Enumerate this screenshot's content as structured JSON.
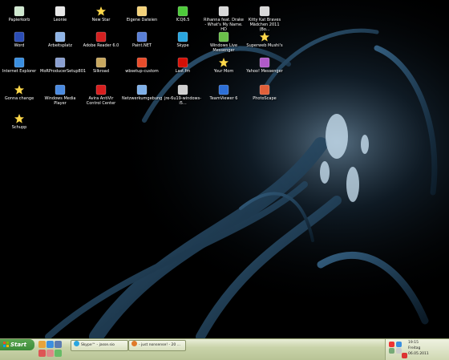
{
  "desktop_icons": [
    {
      "label": "Papierkorb",
      "icon": "recycle-bin-icon",
      "color": "#cfe8cf"
    },
    {
      "label": "Leonie",
      "icon": "document-icon",
      "color": "#e8e8e8"
    },
    {
      "label": "New Star",
      "icon": "star-icon",
      "color": "#ffd84a"
    },
    {
      "label": "Eigene Dateien",
      "icon": "folder-icon",
      "color": "#f4d27a"
    },
    {
      "label": "ICQ6.5",
      "icon": "icq-flower-icon",
      "color": "#4ecb3b"
    },
    {
      "label": "Rihanna feat. Drake - What's My Name. HD",
      "icon": "media-file-icon",
      "color": "#d9d9d9"
    },
    {
      "label": "Kitty Kat Braves Mädchen 2011 (Bo...",
      "icon": "media-file-icon",
      "color": "#d9d9d9"
    },
    {
      "label": "Word",
      "icon": "word-icon",
      "color": "#2b4db5"
    },
    {
      "label": "Arbeitsplatz",
      "icon": "computer-icon",
      "color": "#8fb4e6"
    },
    {
      "label": "Adobe Reader 6.0",
      "icon": "pdf-icon",
      "color": "#d42020"
    },
    {
      "label": "Paint.NET",
      "icon": "paint-icon",
      "color": "#5a7fd6"
    },
    {
      "label": "Skype",
      "icon": "skype-icon",
      "color": "#2aa6e0"
    },
    {
      "label": "Windows Live Messenger",
      "icon": "messenger-icon",
      "color": "#6bc04a"
    },
    {
      "label": "Superweb Mushi's",
      "icon": "star-icon",
      "color": "#ffd84a"
    },
    {
      "label": "Internet Explorer",
      "icon": "internet-explorer-icon",
      "color": "#3b8fe0"
    },
    {
      "label": "MoRProducerSetup801",
      "icon": "setup-icon",
      "color": "#8a9fd0"
    },
    {
      "label": "Silkroad",
      "icon": "game-icon",
      "color": "#c8a860"
    },
    {
      "label": "wbsetup-custom",
      "icon": "windows-flag-icon",
      "color": "#e84c2b"
    },
    {
      "label": "Last.fm",
      "icon": "lastfm-icon",
      "color": "#d51007"
    },
    {
      "label": "Your Mom",
      "icon": "star-icon",
      "color": "#ffd84a"
    },
    {
      "label": "Yahoo! Messenger",
      "icon": "yahoo-icon",
      "color": "#b05ac8"
    },
    {
      "label": "Gonna change",
      "icon": "star-icon",
      "color": "#ffd84a"
    },
    {
      "label": "Windows Media Player",
      "icon": "media-player-icon",
      "color": "#4a8ae0"
    },
    {
      "label": "Avira AntiVir Control Center",
      "icon": "avira-icon",
      "color": "#d81e1e"
    },
    {
      "label": "Netzwerkumgebung",
      "icon": "network-icon",
      "color": "#7fb0e8"
    },
    {
      "label": "jre-6u19-windows-i5...",
      "icon": "installer-icon",
      "color": "#cfcfcf"
    },
    {
      "label": "TeamViewer 6",
      "icon": "teamviewer-icon",
      "color": "#2d6fd6"
    },
    {
      "label": "PhotoScape",
      "icon": "photoscape-icon",
      "color": "#e0603a"
    },
    {
      "label": "Schupp",
      "icon": "star-icon",
      "color": "#ffd84a"
    }
  ],
  "taskbar": {
    "start_label": "Start",
    "tasks": [
      {
        "label": "Skype™ - jasse.sio",
        "icon": "skype-icon",
        "color": "#2aa6e0"
      },
      {
        "label": "- just nonsense! - 20 ...",
        "icon": "firefox-icon",
        "color": "#e07a2a"
      }
    ],
    "clock": {
      "time": "19:15",
      "day": "Freitag",
      "date": "06.05.2011"
    }
  },
  "colors": {
    "taskbar": "#c9d3a9",
    "start": "#3c8b38",
    "wallpaper": "#000000"
  }
}
